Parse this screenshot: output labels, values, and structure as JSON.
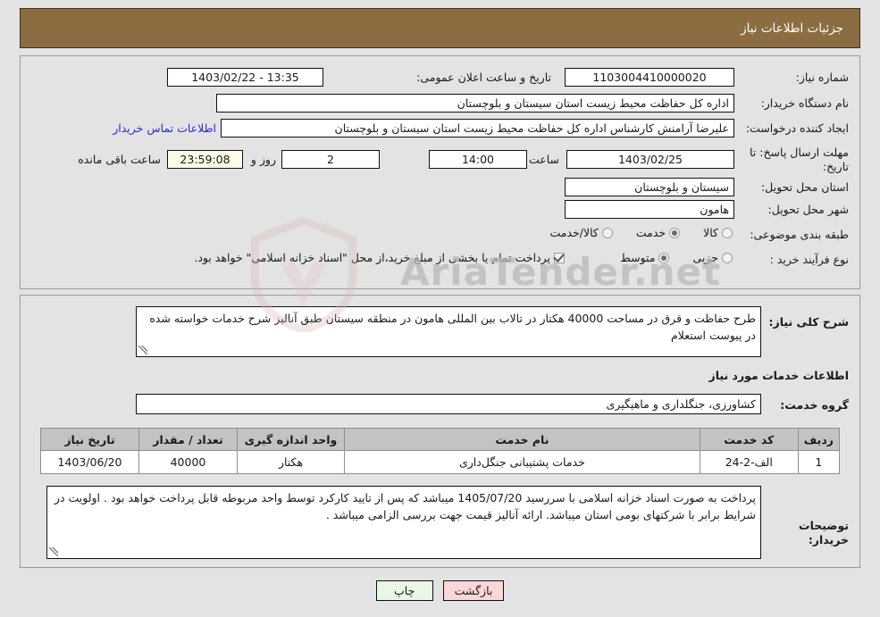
{
  "header": {
    "title": "جزئیات اطلاعات نیاز"
  },
  "main": {
    "fields": {
      "need_number": {
        "label": "شماره نیاز:",
        "value": "1103004410000020"
      },
      "announce_datetime": {
        "label": "تاریخ و ساعت اعلان عمومی:",
        "value": "13:35 - 1403/02/22"
      },
      "buyer_org": {
        "label": "نام دستگاه خریدار:",
        "value": "اداره کل حفاظت محیط زیست استان سیستان و بلوچستان"
      },
      "request_creator": {
        "label": "ایجاد کننده درخواست:",
        "value": "علیرضا آرامنش کارشناس اداره کل حفاظت محیط زیست استان سیستان و بلوچستان"
      },
      "buyer_contact_link": "اطلاعات تماس خریدار",
      "deadline": {
        "label": "مهلت ارسال پاسخ: تا تاریخ:",
        "value": "1403/02/25"
      },
      "deadline_time": {
        "label": "ساعت",
        "value": "14:00"
      },
      "days_left": {
        "value": "2",
        "label": "روز و"
      },
      "time_left": {
        "value": "23:59:08",
        "label": "ساعت باقی مانده"
      },
      "delivery_province": {
        "label": "استان محل تحویل:",
        "value": "سیستان و بلوچستان"
      },
      "delivery_city": {
        "label": "شهر محل تحویل:",
        "value": "هامون"
      }
    },
    "category": {
      "label": "طبقه بندی موضوعی:",
      "options": [
        {
          "label": "کالا",
          "selected": false
        },
        {
          "label": "خدمت",
          "selected": true
        },
        {
          "label": "کالا/خدمت",
          "selected": false
        }
      ]
    },
    "purchase_type": {
      "label": "نوع فرآیند خرید :",
      "options": [
        {
          "label": "جزیی",
          "selected": false
        },
        {
          "label": "متوسط",
          "selected": true
        }
      ]
    },
    "treasury_checkbox": {
      "checked": true,
      "label": "پرداخت تمام یا بخشی از مبلغ خرید،از محل \"اسناد خزانه اسلامی\" خواهد بود."
    }
  },
  "description": {
    "label": "شرح کلی نیاز:",
    "value": "طرح حفاظت و قرق در مساحت 40000 هکتار در تالاب  بین المللی هامون در منطقه سیستان طبق آنالیز شرح خدمات خواسته شده در پیوست استعلام",
    "services_heading": "اطلاعات خدمات مورد نیاز",
    "service_group": {
      "label": "گروه خدمت:",
      "value": "کشاورزی، جنگلداری و ماهیگیری"
    }
  },
  "items_table": {
    "headers": [
      "ردیف",
      "کد خدمت",
      "نام خدمت",
      "واحد اندازه گیری",
      "تعداد / مقدار",
      "تاریخ نیاز"
    ],
    "rows": [
      {
        "radif": "1",
        "code": "الف-2-24",
        "name": "خدمات پشتیبانی جنگل‌داری",
        "unit": "هکتار",
        "qty": "40000",
        "date": "1403/06/20"
      }
    ]
  },
  "buyer_notes": {
    "label": "توضیحات خریدار:",
    "value": "پرداخت به صورت اسناد خزانه اسلامی با سررسید 1405/07/20 میباشد که پس از تایید کارکرد توسط واحد مربوطه قابل پرداخت خواهد بود . اولویت در شرایط برابر با شرکتهای بومی استان میباشد. ارائه آنالیز قیمت جهت بررسی الزامی میباشد ."
  },
  "buttons": {
    "print": "چاپ",
    "back": "بازگشت"
  },
  "watermark": {
    "text": "AriaTender.net"
  },
  "colors": {
    "header_brown": "#8c6d41",
    "page_bg": "#e3e3e3",
    "table_header": "#c3c3c3",
    "link_blue": "#2b2bd4",
    "timer_bg": "#fbfbe8",
    "print_btn": "#eaf6e6",
    "back_btn": "#fbd7d7"
  }
}
